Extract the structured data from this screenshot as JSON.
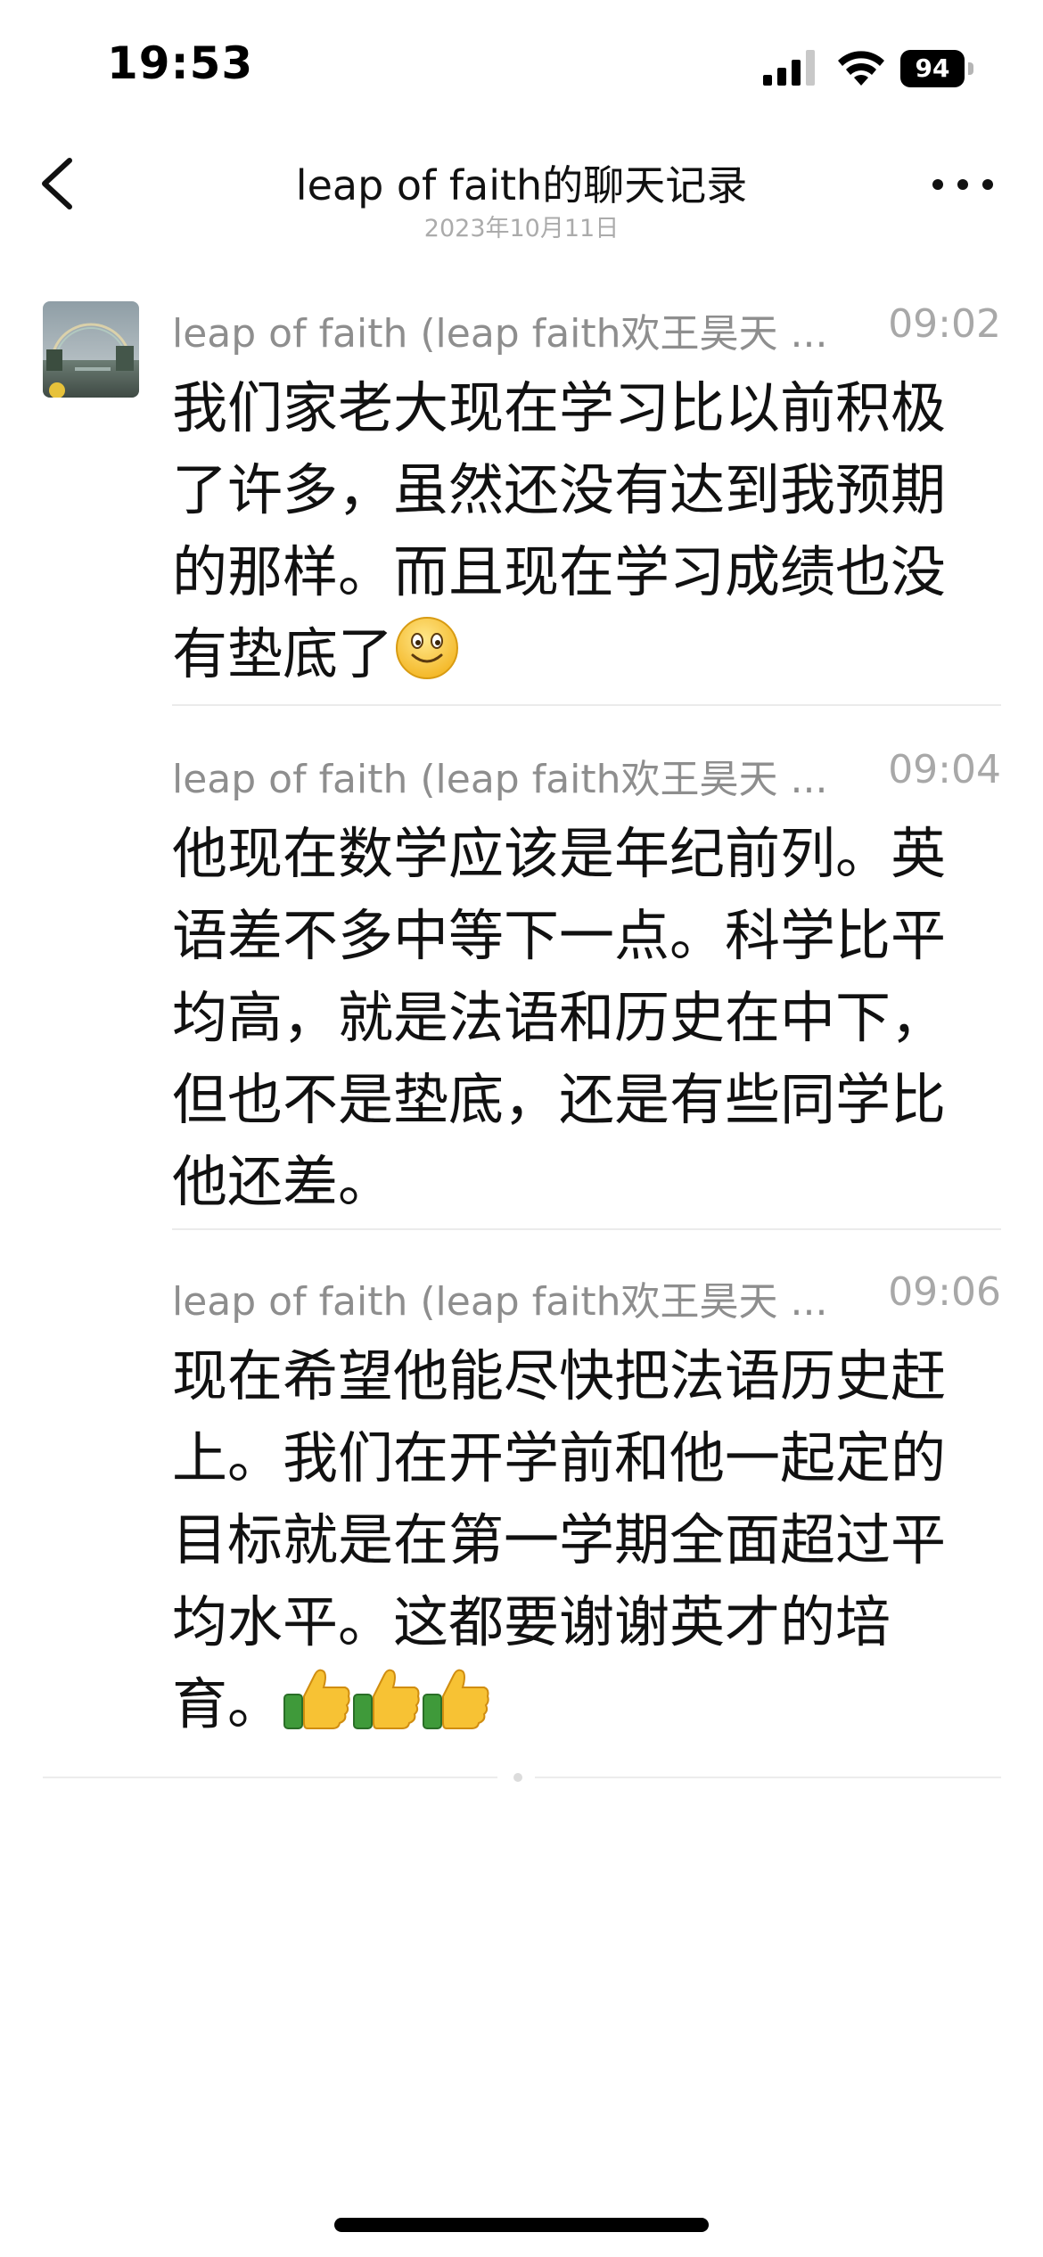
{
  "status_bar": {
    "time": "19:53",
    "battery": "94",
    "icons": [
      "cellular-signal-icon",
      "wifi-icon",
      "battery-icon"
    ]
  },
  "header": {
    "title": "leap of faith的聊天记录",
    "date": "2023年10月11日",
    "icons": [
      "back-chevron-icon",
      "more-dots-icon"
    ]
  },
  "messages": [
    {
      "sender": "leap of faith (leap faith欢王昊天 ...",
      "time": "09:02",
      "text": "我们家老大现在学习比以前积极了许多，虽然还没有达到我预期的那样。而且现在学习成绩也没有垫底了",
      "emoji": "smiling-face-emoji"
    },
    {
      "sender": "leap of faith (leap faith欢王昊天 ...",
      "time": "09:04",
      "text": "他现在数学应该是年纪前列。英语差不多中等下一点。科学比平均高，就是法语和历史在中下，但也不是垫底，还是有些同学比他还差。"
    },
    {
      "sender": "leap of faith (leap faith欢王昊天 ...",
      "time": "09:06",
      "text": "现在希望他能尽快把法语历史赶上。我们在开学前和他一起定的目标就是在第一学期全面超过平均水平。这都要谢谢英才的培育。",
      "emoji": "thumbs-up-emoji x3"
    }
  ],
  "colors": {
    "background": "#ffffff",
    "meta_text": "#8e8e8e",
    "divider": "#ebebeb",
    "text": "#111111"
  }
}
